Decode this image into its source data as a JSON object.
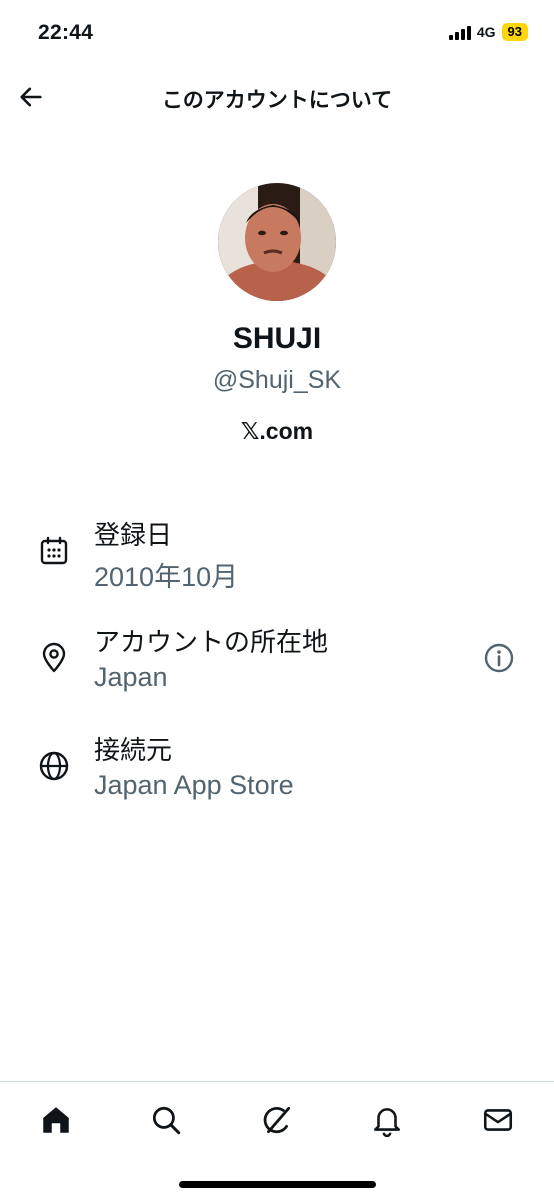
{
  "status_bar": {
    "time": "22:44",
    "network": "4G",
    "battery": "93"
  },
  "header": {
    "title": "このアカウントについて"
  },
  "profile": {
    "name": "SHUJI",
    "handle": "@Shuji_SK",
    "site": "𝕏.com"
  },
  "details": [
    {
      "label": "登録日",
      "value": "2010年10月",
      "icon": "calendar-icon"
    },
    {
      "label": "アカウントの所在地",
      "value": "Japan",
      "icon": "location-pin-icon"
    },
    {
      "label": "接続元",
      "value": "Japan App Store",
      "icon": "globe-icon"
    }
  ],
  "tab_bar": {
    "items": [
      "home-icon",
      "search-icon",
      "grok-icon",
      "notifications-bell-icon",
      "messages-envelope-icon"
    ]
  },
  "colors": {
    "text": "#0f1419",
    "secondary_text": "#536471",
    "battery": "#ffd60a",
    "divider": "#cfd9de"
  }
}
